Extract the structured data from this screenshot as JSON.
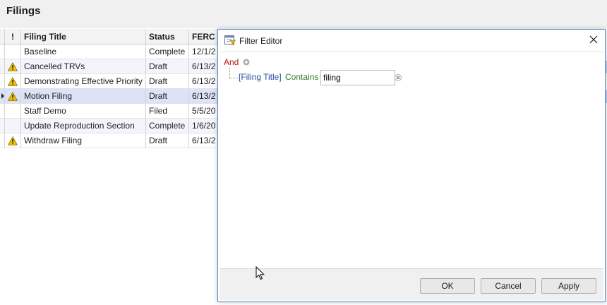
{
  "page": {
    "title": "Filings"
  },
  "grid": {
    "columns": {
      "warning": "!",
      "title": "Filing Title",
      "status": "Status",
      "ferc": "FERC F"
    },
    "rows": [
      {
        "title": "Baseline",
        "status": "Complete",
        "ferc": "12/1/2",
        "warning": false
      },
      {
        "title": "Cancelled TRVs",
        "status": "Draft",
        "ferc": "6/13/2",
        "warning": true
      },
      {
        "title": "Demonstrating Effective Priority",
        "status": "Draft",
        "ferc": "6/13/2",
        "warning": true
      },
      {
        "title": "Motion Filing",
        "status": "Draft",
        "ferc": "6/13/2",
        "warning": true,
        "selected": true
      },
      {
        "title": "Staff Demo",
        "status": "Filed",
        "ferc": "5/5/20",
        "warning": false
      },
      {
        "title": "Update Reproduction Section",
        "status": "Complete",
        "ferc": "1/6/20",
        "warning": false
      },
      {
        "title": "Withdraw Filing",
        "status": "Draft",
        "ferc": "6/13/2",
        "warning": true
      }
    ]
  },
  "dialog": {
    "title": "Filter Editor",
    "group_operator": "And",
    "condition": {
      "field": "[Filing Title]",
      "operator": "Contains",
      "value": "filing"
    },
    "buttons": {
      "ok": "OK",
      "cancel": "Cancel",
      "apply": "Apply"
    }
  },
  "colors": {
    "group_operator": "#b01818",
    "field": "#2b4fa3",
    "operator": "#2f7a2f",
    "selected_row": "#dde3f6",
    "dialog_border": "#5b8ccf"
  },
  "icons": {
    "warning": "warning-triangle-icon",
    "add_condition": "add-circle-icon",
    "remove_condition": "remove-circle-icon",
    "dialog": "filter-editor-icon",
    "close": "close-icon",
    "cursor": "mouse-pointer-icon"
  }
}
